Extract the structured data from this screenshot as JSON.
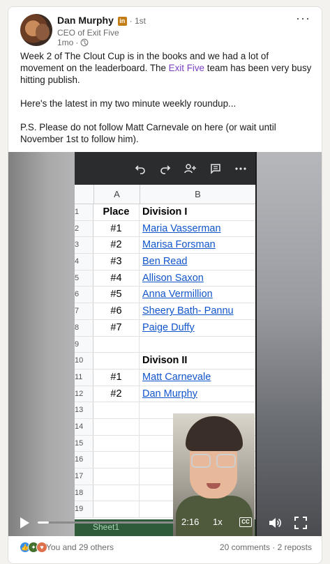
{
  "post": {
    "author_name": "Dan Murphy",
    "badge": "in",
    "degree": "· 1st",
    "headline": "CEO of Exit Five",
    "time": "1mo",
    "time_sep": "·",
    "more_label": "···",
    "text_p1_a": "Week 2 of The Clout Cup is in the books and we had a lot of movement on the leaderboard. The ",
    "text_p1_mention": "Exit Five",
    "text_p1_b": " team has been very busy hitting publish.",
    "text_p2": "Here's the latest in my two minute weekly roundup...",
    "text_p3": "P.S. Please do not follow Matt Carnevale on here (or wait until November 1st to follow him).",
    "mention_color": "#7b3fc4"
  },
  "video": {
    "sheet": {
      "col_a_header": "A",
      "col_b_header": "B",
      "rows": [
        {
          "num": "1",
          "a": "Place",
          "b": "Division I",
          "bold": true,
          "link": false
        },
        {
          "num": "2",
          "a": "#1",
          "b": "Maria Vasserman",
          "bold": false,
          "link": true
        },
        {
          "num": "3",
          "a": "#2",
          "b": "Marisa Forsman",
          "bold": false,
          "link": true
        },
        {
          "num": "4",
          "a": "#3",
          "b": "Ben Read",
          "bold": false,
          "link": true
        },
        {
          "num": "5",
          "a": "#4",
          "b": "Allison Saxon",
          "bold": false,
          "link": true
        },
        {
          "num": "6",
          "a": "#5",
          "b": "Anna Vermillion",
          "bold": false,
          "link": true
        },
        {
          "num": "7",
          "a": "#6",
          "b": "Sheery Bath- Pannu",
          "bold": false,
          "link": true
        },
        {
          "num": "8",
          "a": "#7",
          "b": "Paige Duffy",
          "bold": false,
          "link": true
        },
        {
          "num": "9",
          "a": "",
          "b": "",
          "bold": false,
          "link": false
        },
        {
          "num": "10",
          "a": "",
          "b": "Divison II",
          "bold": true,
          "link": false
        },
        {
          "num": "11",
          "a": "#1",
          "b": "Matt Carnevale",
          "bold": false,
          "link": true
        },
        {
          "num": "12",
          "a": "#2",
          "b": "Dan Murphy",
          "bold": false,
          "link": true
        },
        {
          "num": "13",
          "a": "",
          "b": "",
          "bold": false,
          "link": false
        },
        {
          "num": "14",
          "a": "",
          "b": "",
          "bold": false,
          "link": false
        },
        {
          "num": "15",
          "a": "",
          "b": "",
          "bold": false,
          "link": false
        },
        {
          "num": "16",
          "a": "",
          "b": "",
          "bold": false,
          "link": false
        },
        {
          "num": "17",
          "a": "",
          "b": "",
          "bold": false,
          "link": false
        },
        {
          "num": "18",
          "a": "",
          "b": "",
          "bold": false,
          "link": false
        },
        {
          "num": "19",
          "a": "",
          "b": "",
          "bold": false,
          "link": false
        }
      ],
      "tab_label": "Sheet1",
      "link_color": "#1155cc"
    },
    "controls": {
      "time": "2:16",
      "speed": "1x",
      "cc": "CC",
      "progress_fraction": 0.08
    }
  },
  "social": {
    "reaction_count": "You and 29 others",
    "comments": "20 comments",
    "sep": "·",
    "reposts": "2 reposts"
  }
}
